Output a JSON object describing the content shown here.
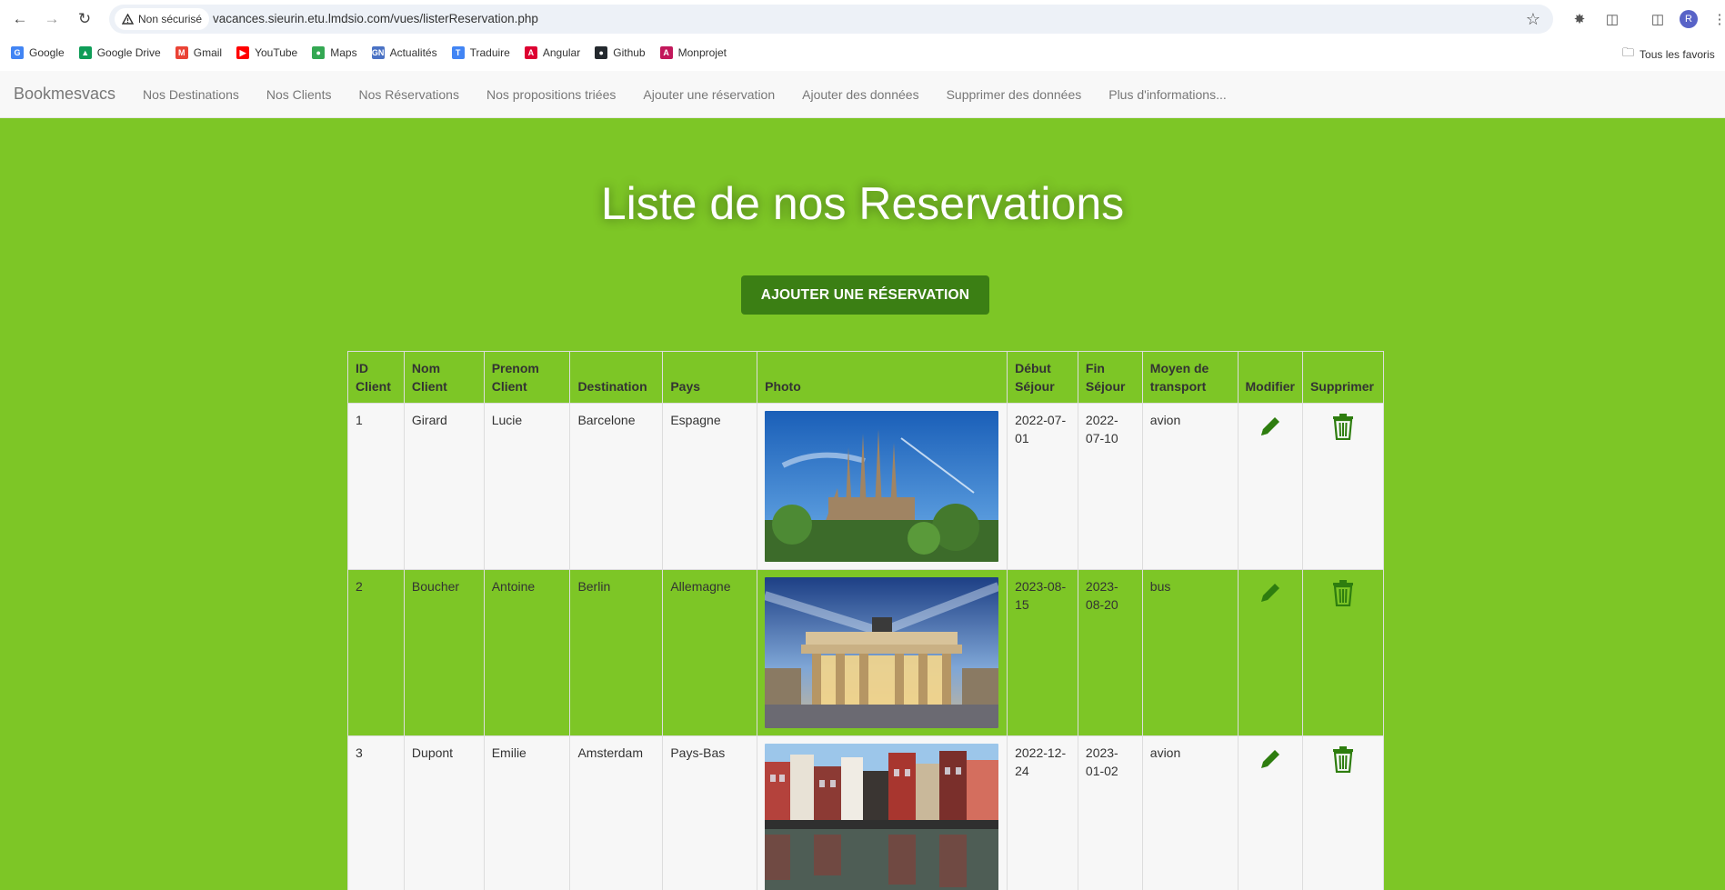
{
  "browser": {
    "security_label": "Non sécurisé",
    "url": "vacances.sieurin.etu.lmdsio.com/vues/listerReservation.php",
    "avatar_letter": "R",
    "bookmarks": [
      {
        "label": "Google",
        "icon": "google-icon",
        "color": "#4285f4"
      },
      {
        "label": "Google Drive",
        "icon": "drive-icon",
        "color": "#0f9d58"
      },
      {
        "label": "Gmail",
        "icon": "gmail-icon",
        "color": "#ea4335"
      },
      {
        "label": "YouTube",
        "icon": "youtube-icon",
        "color": "#ff0000"
      },
      {
        "label": "Maps",
        "icon": "maps-icon",
        "color": "#34a853"
      },
      {
        "label": "Actualités",
        "icon": "news-icon",
        "color": "#4a72c4"
      },
      {
        "label": "Traduire",
        "icon": "translate-icon",
        "color": "#4285f4"
      },
      {
        "label": "Angular",
        "icon": "angular-icon",
        "color": "#dd0031"
      },
      {
        "label": "Github",
        "icon": "github-icon",
        "color": "#24292e"
      },
      {
        "label": "Monprojet",
        "icon": "angular-icon",
        "color": "#c2185b"
      }
    ],
    "bookmarks_folder": "Tous les favoris"
  },
  "navbar": {
    "brand": "Bookmesvacs",
    "links": [
      "Nos Destinations",
      "Nos Clients",
      "Nos Réservations",
      "Nos propositions triées",
      "Ajouter une réservation",
      "Ajouter des données",
      "Supprimer des données",
      "Plus d'informations..."
    ]
  },
  "main": {
    "title": "Liste de nos Reservations",
    "add_button": "AJOUTER UNE RÉSERVATION"
  },
  "table": {
    "headers": [
      "ID Client",
      "Nom Client",
      "Prenom Client",
      "Destination",
      "Pays",
      "Photo",
      "Début Séjour",
      "Fin Séjour",
      "Moyen de transport",
      "Modifier",
      "Supprimer"
    ],
    "rows": [
      {
        "id": "1",
        "nom": "Girard",
        "prenom": "Lucie",
        "destination": "Barcelone",
        "pays": "Espagne",
        "photo": "sagrada-familia-photo",
        "debut": "2022-07-01",
        "fin": "2022-07-10",
        "transport": "avion"
      },
      {
        "id": "2",
        "nom": "Boucher",
        "prenom": "Antoine",
        "destination": "Berlin",
        "pays": "Allemagne",
        "photo": "brandenburg-gate-photo",
        "debut": "2023-08-15",
        "fin": "2023-08-20",
        "transport": "bus"
      },
      {
        "id": "3",
        "nom": "Dupont",
        "prenom": "Emilie",
        "destination": "Amsterdam",
        "pays": "Pays-Bas",
        "photo": "amsterdam-canal-photo",
        "debut": "2022-12-24",
        "fin": "2023-01-02",
        "transport": "avion"
      }
    ]
  },
  "colors": {
    "page_bg": "#7dc626",
    "button_bg": "#3b7f14",
    "icon_green": "#2e7d0f"
  }
}
